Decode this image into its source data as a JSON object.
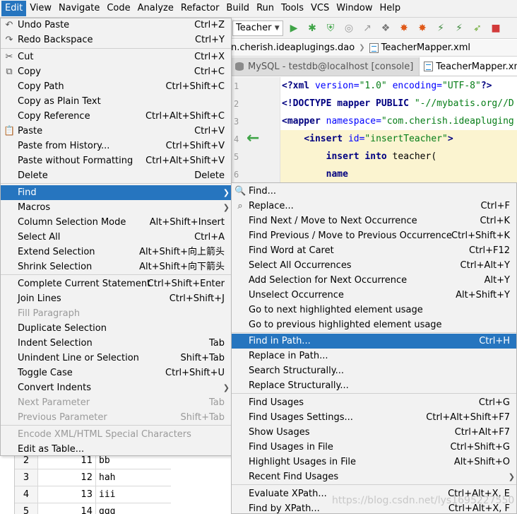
{
  "menubar": {
    "items": [
      "Edit",
      "View",
      "Navigate",
      "Code",
      "Analyze",
      "Refactor",
      "Build",
      "Run",
      "Tools",
      "VCS",
      "Window",
      "Help"
    ],
    "active_index": 0
  },
  "toolbar": {
    "run_config": "Teacher",
    "icons": [
      "run-icon",
      "debug-icon",
      "coverage-icon",
      "profile-icon",
      "attach-icon",
      "build-icon",
      "plugin-icon",
      "jr-icon",
      "jr-debug-icon",
      "jrebel-icon",
      "stop-icon"
    ]
  },
  "breadcrumb": {
    "package": "n.cherish.ideaplugings.dao",
    "file": "TeacherMapper.xml"
  },
  "tabs": [
    {
      "label": "MySQL - testdb@localhost [console]",
      "active": false
    },
    {
      "label": "TeacherMapper.xml",
      "active": true
    }
  ],
  "editor": {
    "line_numbers": [
      "1",
      "2",
      "3",
      "4",
      "5",
      "6"
    ],
    "lines": [
      {
        "parts": [
          [
            "k-tag",
            "<?"
          ],
          [
            "k-tag",
            "xml "
          ],
          [
            "k-attr",
            "version="
          ],
          [
            "k-str",
            "\"1.0\" "
          ],
          [
            "k-attr",
            "encoding="
          ],
          [
            "k-str",
            "\"UTF-8\""
          ],
          [
            "k-tag",
            "?>"
          ]
        ]
      },
      {
        "parts": [
          [
            "k-tag",
            "<!DOCTYPE mapper PUBLIC "
          ],
          [
            "k-str",
            "\"-//mybatis.org//D"
          ]
        ]
      },
      {
        "parts": [
          [
            "k-tag",
            "<mapper "
          ],
          [
            "k-attr",
            "namespace="
          ],
          [
            "k-str",
            "\"com.cherish.ideapluging"
          ]
        ]
      },
      {
        "parts": [
          [
            "k-plain",
            "    "
          ],
          [
            "k-tag",
            "<insert "
          ],
          [
            "k-attr",
            "id="
          ],
          [
            "k-str",
            "\"insertTeacher\""
          ],
          [
            "k-tag",
            ">"
          ]
        ]
      },
      {
        "parts": [
          [
            "k-plain",
            "        "
          ],
          [
            "k-kw",
            "insert into "
          ],
          [
            "k-plain",
            "teacher("
          ]
        ]
      },
      {
        "parts": [
          [
            "k-plain",
            "        "
          ],
          [
            "k-kw",
            "name"
          ]
        ]
      }
    ]
  },
  "edit_menu": {
    "items": [
      {
        "label": "Undo Paste",
        "shortcut": "Ctrl+Z",
        "icon": "undo-icon"
      },
      {
        "label": "Redo Backspace",
        "shortcut": "Ctrl+Y",
        "icon": "redo-icon"
      },
      {
        "label": "Cut",
        "shortcut": "Ctrl+X",
        "icon": "cut-icon"
      },
      {
        "label": "Copy",
        "shortcut": "Ctrl+C",
        "icon": "copy-icon"
      },
      {
        "label": "Copy Path",
        "shortcut": "Ctrl+Shift+C"
      },
      {
        "label": "Copy as Plain Text",
        "shortcut": ""
      },
      {
        "label": "Copy Reference",
        "shortcut": "Ctrl+Alt+Shift+C"
      },
      {
        "label": "Paste",
        "shortcut": "Ctrl+V",
        "icon": "paste-icon"
      },
      {
        "label": "Paste from History...",
        "shortcut": "Ctrl+Shift+V"
      },
      {
        "label": "Paste without Formatting",
        "shortcut": "Ctrl+Alt+Shift+V"
      },
      {
        "label": "Delete",
        "shortcut": "Delete"
      },
      {
        "label": "Find",
        "shortcut": "",
        "submenu": true,
        "selected": true
      },
      {
        "label": "Macros",
        "shortcut": "",
        "submenu": true
      },
      {
        "label": "Column Selection Mode",
        "shortcut": "Alt+Shift+Insert"
      },
      {
        "label": "Select All",
        "shortcut": "Ctrl+A"
      },
      {
        "label": "Extend Selection",
        "shortcut": "Alt+Shift+向上箭头"
      },
      {
        "label": "Shrink Selection",
        "shortcut": "Alt+Shift+向下箭头"
      },
      {
        "label": "Complete Current Statement",
        "shortcut": "Ctrl+Shift+Enter"
      },
      {
        "label": "Join Lines",
        "shortcut": "Ctrl+Shift+J"
      },
      {
        "label": "Fill Paragraph",
        "shortcut": "",
        "disabled": true
      },
      {
        "label": "Duplicate Selection",
        "shortcut": ""
      },
      {
        "label": "Indent Selection",
        "shortcut": "Tab"
      },
      {
        "label": "Unindent Line or Selection",
        "shortcut": "Shift+Tab"
      },
      {
        "label": "Toggle Case",
        "shortcut": "Ctrl+Shift+U"
      },
      {
        "label": "Convert Indents",
        "shortcut": "",
        "submenu": true
      },
      {
        "label": "Next Parameter",
        "shortcut": "Tab",
        "disabled": true
      },
      {
        "label": "Previous Parameter",
        "shortcut": "Shift+Tab",
        "disabled": true
      },
      {
        "label": "Encode XML/HTML Special Characters",
        "shortcut": "",
        "disabled": true
      },
      {
        "label": "Edit as Table...",
        "shortcut": ""
      }
    ]
  },
  "find_menu": {
    "items": [
      {
        "label": "Find...",
        "shortcut": "",
        "icon": "search-icon"
      },
      {
        "label": "Replace...",
        "shortcut": "Ctrl+F",
        "icon": "replace-icon"
      },
      {
        "label": "Find Next / Move to Next Occurrence",
        "shortcut": "Ctrl+K"
      },
      {
        "label": "Find Previous / Move to Previous Occurrence",
        "shortcut": "Ctrl+Shift+K"
      },
      {
        "label": "Find Word at Caret",
        "shortcut": "Ctrl+F12"
      },
      {
        "label": "Select All Occurrences",
        "shortcut": "Ctrl+Alt+Y"
      },
      {
        "label": "Add Selection for Next Occurrence",
        "shortcut": "Alt+Y"
      },
      {
        "label": "Unselect Occurrence",
        "shortcut": "Alt+Shift+Y"
      },
      {
        "label": "Go to next highlighted element usage",
        "shortcut": ""
      },
      {
        "label": "Go to previous highlighted element usage",
        "shortcut": ""
      },
      {
        "label": "Find in Path...",
        "shortcut": "Ctrl+H",
        "selected": true
      },
      {
        "label": "Replace in Path...",
        "shortcut": ""
      },
      {
        "label": "Search Structurally...",
        "shortcut": ""
      },
      {
        "label": "Replace Structurally...",
        "shortcut": ""
      },
      {
        "label": "Find Usages",
        "shortcut": "Ctrl+G"
      },
      {
        "label": "Find Usages Settings...",
        "shortcut": "Ctrl+Alt+Shift+F7"
      },
      {
        "label": "Show Usages",
        "shortcut": "Ctrl+Alt+F7"
      },
      {
        "label": "Find Usages in File",
        "shortcut": "Ctrl+Shift+G"
      },
      {
        "label": "Highlight Usages in File",
        "shortcut": "Alt+Shift+O"
      },
      {
        "label": "Recent Find Usages",
        "shortcut": "",
        "submenu": true
      },
      {
        "label": "Evaluate XPath...",
        "shortcut": "Ctrl+Alt+X, E"
      },
      {
        "label": "Find by XPath...",
        "shortcut": "Ctrl+Alt+X, F"
      }
    ]
  },
  "table": {
    "rows": [
      {
        "index": "2",
        "id": "11",
        "name": "bb"
      },
      {
        "index": "3",
        "id": "12",
        "name": "hah"
      },
      {
        "index": "4",
        "id": "13",
        "name": "iii"
      },
      {
        "index": "5",
        "id": "14",
        "name": "ggg"
      }
    ]
  },
  "watermark": "https://blog.csdn.net/lys1695227550"
}
